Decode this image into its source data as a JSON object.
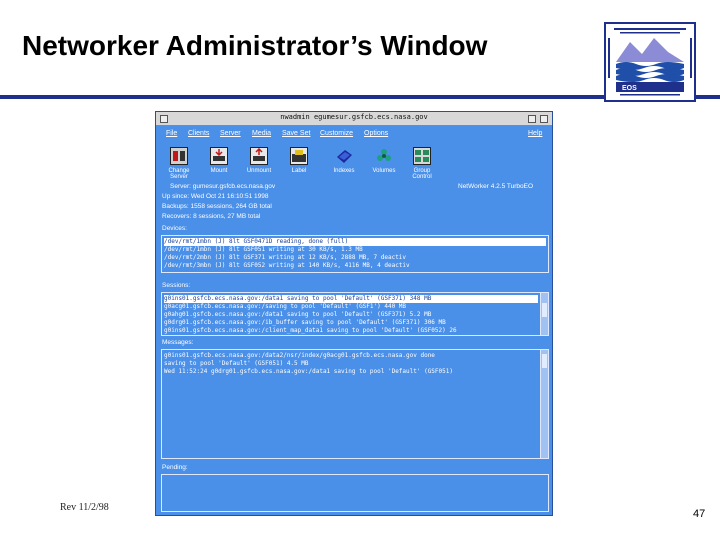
{
  "slide": {
    "title": "Networker Administrator’s Window",
    "footer_rev": "Rev 11/2/98",
    "page_number": "47",
    "accent_color": "#1f2f8c",
    "logo_text": "EOS"
  },
  "window": {
    "title": "nwadmin  egumesur.gsfcb.ecs.nasa.gov",
    "background_color": "#4a8fe8"
  },
  "menu": {
    "file": "File",
    "clients": "Clients",
    "server": "Server",
    "media": "Media",
    "save_set": "Save Set",
    "customize": "Customize",
    "options": "Options",
    "help": "Help"
  },
  "toolbar": {
    "change_server_l1": "Change",
    "change_server_l2": "Server",
    "mount": "Mount",
    "unmount": "Unmount",
    "label": "Label",
    "indexes": "Indexes",
    "volumes": "Volumes",
    "group_control_l1": "Group",
    "group_control_l2": "Control"
  },
  "info": {
    "server_line": "Server: gumesur.gsfcb.ecs.nasa.gov",
    "version": "NetWorker 4.2.5 TurboEO",
    "up_since": "Up since: Wed Oct 21 16:10:51 1998",
    "backups": "Backups: 1558 sessions, 264 GB total",
    "recovers": "Recovers: 8 sessions, 27 MB total"
  },
  "devices": {
    "label": "Devices:",
    "rows": [
      "/dev/rmt/1mbn  (J)     8lt  GSF0471D     reading, done (full)",
      "/dev/rmt/1mbn  (J)     8lt  GSF051       writing at 30 KB/s, 1.3 MB",
      "/dev/rmt/2mbn  (J)     8lt  GSF371       writing at 12 KB/s, 2888 MB, 7 deactiv",
      "/dev/rmt/3mbn  (J)     8lt  GSF052       writing at 140 KB/s, 4116 MB, 4 deactiv"
    ]
  },
  "sessions": {
    "label": "Sessions:",
    "rows": [
      "g0ins01.gsfcb.ecs.nasa.gov:/data1 saving to pool 'Default' (GSF371) 348 MB",
      "g0acg01.gsfcb.ecs.nasa.gov:/saving to pool 'Default' (GSF1') 440 MB",
      "g0ahg01.gsfcb.ecs.nasa.gov:/data1 saving to pool 'Default' (GSF371) 5.2 MB",
      "g0drg01.gsfcb.ecs.nasa.gov:/ib_buffer saving to pool 'Default' (GSF371) 306 MB",
      "g0ins01.gsfcb.ecs.nasa.gov:/client_map_data1 saving to pool 'Default' (GSF052) 26"
    ]
  },
  "messages": {
    "label": "Messages:",
    "rows": [
      "g0ins01.gsfcb.ecs.nasa.gov:/data2/nsr/index/g0acg01.gsfcb.ecs.nasa.gov done",
      "saving to pool 'Default' (GSF051) 4.5 MB",
      "Wed 11:52:24 g0drg01.gsfcb.ecs.nasa.gov:/data1 saving to pool 'Default' (GSF051)"
    ]
  },
  "pending": {
    "label": "Pending:"
  }
}
